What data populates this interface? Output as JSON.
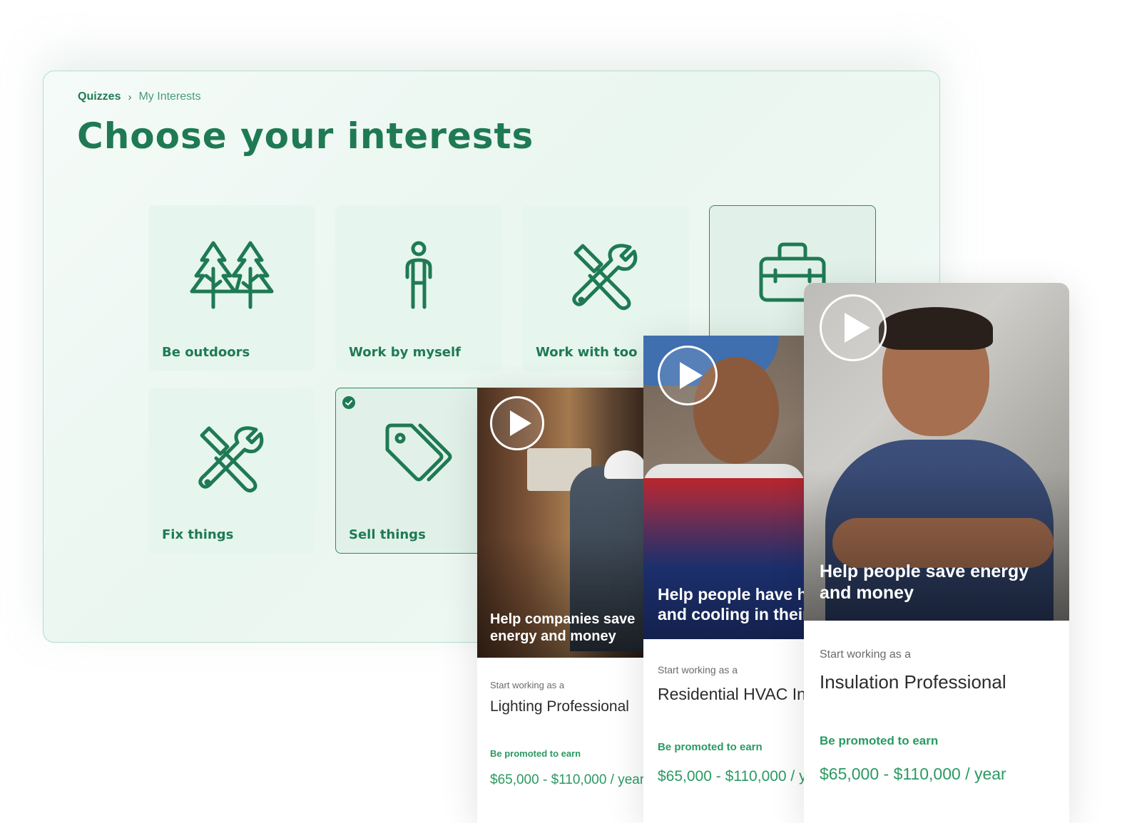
{
  "breadcrumb": {
    "root": "Quizzes",
    "separator": "›",
    "current": "My Interests"
  },
  "title": "Choose your interests",
  "interests": [
    {
      "label": "Be outdoors",
      "icon": "trees-icon"
    },
    {
      "label": "Work by myself",
      "icon": "person-icon"
    },
    {
      "label": "Work with too",
      "icon": "tools-icon"
    },
    {
      "label": "",
      "icon": "toolbox-icon"
    },
    {
      "label": "Fix things",
      "icon": "tools-icon"
    },
    {
      "label": "Sell things",
      "icon": "price-tags-icon",
      "selected": true
    }
  ],
  "cards": [
    {
      "caption_lines": [
        "Help companies save",
        "energy and money"
      ],
      "start_label": "Start working as a",
      "role": "Lighting Professional",
      "promo_label": "Be promoted to earn",
      "salary": "$65,000 - $110,000 / year"
    },
    {
      "caption_lines": [
        "Help people have h",
        "and cooling in their"
      ],
      "start_label": "Start working as a",
      "role": "Residential HVAC In",
      "promo_label": "Be promoted to earn",
      "salary": "$65,000 - $110,000 / y"
    },
    {
      "caption_lines": [
        "Help people save energy",
        "and money"
      ],
      "start_label": "Start working as a",
      "role": "Insulation Professional",
      "promo_label": "Be promoted to earn",
      "salary": "$65,000 - $110,000 / year"
    }
  ],
  "colors": {
    "brand_green": "#1f7a54",
    "tile_bg": "#e6f6ee",
    "earn_green": "#2a9a62"
  }
}
